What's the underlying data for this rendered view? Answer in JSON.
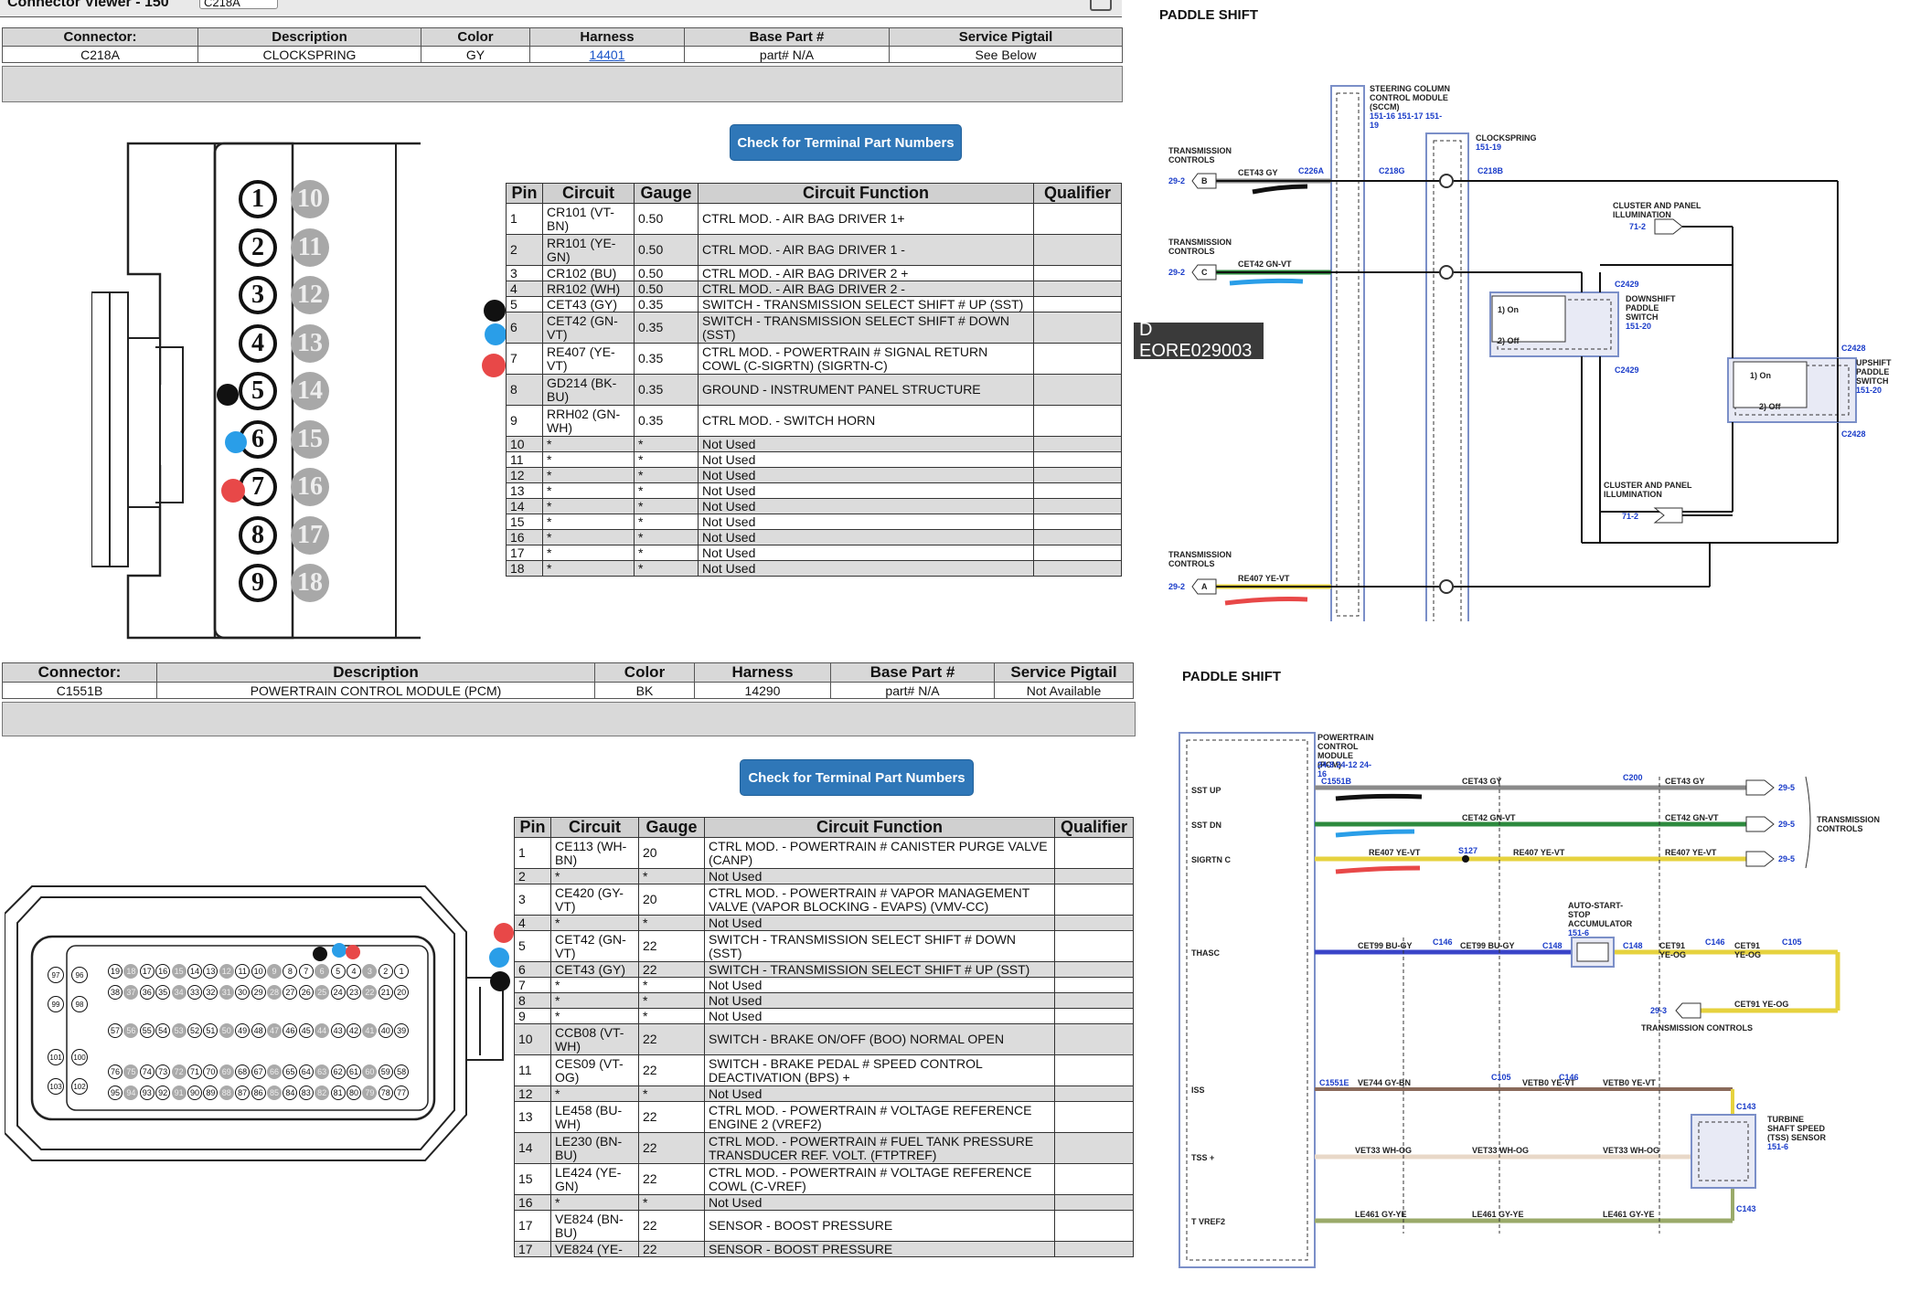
{
  "top_connector": {
    "viewer_label": "Connector Viewer - 150",
    "viewer_select": "C218A",
    "headers": [
      "Connector:",
      "Description",
      "Color",
      "Harness",
      "Base Part #",
      "Service Pigtail"
    ],
    "values": [
      "C218A",
      "CLOCKSPRING",
      "GY",
      "14401",
      "part# N/A",
      "See Below"
    ],
    "button": "Check for Terminal Part Numbers",
    "pin_headers": [
      "Pin",
      "Circuit",
      "Gauge",
      "Circuit Function",
      "Qualifier"
    ],
    "pins": [
      [
        "1",
        "CR101 (VT-BN)",
        "0.50",
        "CTRL MOD. - AIR BAG DRIVER 1+",
        ""
      ],
      [
        "2",
        "RR101 (YE-GN)",
        "0.50",
        "CTRL MOD. - AIR BAG DRIVER 1 -",
        ""
      ],
      [
        "3",
        "CR102 (BU)",
        "0.50",
        "CTRL MOD. - AIR BAG DRIVER 2 +",
        ""
      ],
      [
        "4",
        "RR102 (WH)",
        "0.50",
        "CTRL MOD. - AIR BAG DRIVER 2 -",
        ""
      ],
      [
        "5",
        "CET43 (GY)",
        "0.35",
        "SWITCH - TRANSMISSION SELECT SHIFT # UP (SST)",
        ""
      ],
      [
        "6",
        "CET42 (GN-VT)",
        "0.35",
        "SWITCH - TRANSMISSION SELECT SHIFT # DOWN (SST)",
        ""
      ],
      [
        "7",
        "RE407 (YE-VT)",
        "0.35",
        "CTRL MOD. - POWERTRAIN # SIGNAL RETURN COWL (C-SIGRTN) (SIGRTN-C)",
        ""
      ],
      [
        "8",
        "GD214 (BK-BU)",
        "0.35",
        "GROUND - INSTRUMENT PANEL STRUCTURE",
        ""
      ],
      [
        "9",
        "RRH02 (GN-WH)",
        "0.35",
        "CTRL MOD. - SWITCH HORN",
        ""
      ],
      [
        "10",
        "*",
        "*",
        "Not Used",
        ""
      ],
      [
        "11",
        "*",
        "*",
        "Not Used",
        ""
      ],
      [
        "12",
        "*",
        "*",
        "Not Used",
        ""
      ],
      [
        "13",
        "*",
        "*",
        "Not Used",
        ""
      ],
      [
        "14",
        "*",
        "*",
        "Not Used",
        ""
      ],
      [
        "15",
        "*",
        "*",
        "Not Used",
        ""
      ],
      [
        "16",
        "*",
        "*",
        "Not Used",
        ""
      ],
      [
        "17",
        "*",
        "*",
        "Not Used",
        ""
      ],
      [
        "18",
        "*",
        "*",
        "Not Used",
        ""
      ]
    ],
    "face_left": [
      "1",
      "2",
      "3",
      "4",
      "5",
      "6",
      "7",
      "8",
      "9"
    ],
    "face_right": [
      "10",
      "11",
      "12",
      "13",
      "14",
      "15",
      "16",
      "17",
      "18"
    ]
  },
  "bottom_connector": {
    "headers": [
      "Connector:",
      "Description",
      "Color",
      "Harness",
      "Base Part #",
      "Service Pigtail"
    ],
    "values": [
      "C1551B",
      "POWERTRAIN CONTROL MODULE (PCM)",
      "BK",
      "14290",
      "part# N/A",
      "Not Available"
    ],
    "button": "Check for Terminal Part Numbers",
    "pin_headers": [
      "Pin",
      "Circuit",
      "Gauge",
      "Circuit Function",
      "Qualifier"
    ],
    "pins": [
      [
        "1",
        "CE113 (WH-BN)",
        "20",
        "CTRL MOD. - POWERTRAIN # CANISTER PURGE VALVE (CANP)",
        ""
      ],
      [
        "2",
        "*",
        "*",
        "Not Used",
        ""
      ],
      [
        "3",
        "CE420 (GY-VT)",
        "20",
        "CTRL MOD. - POWERTRAIN # VAPOR MANAGEMENT VALVE (VAPOR BLOCKING - EVAPS) (VMV-CC)",
        ""
      ],
      [
        "4",
        "*",
        "*",
        "Not Used",
        ""
      ],
      [
        "5",
        "CET42 (GN-VT)",
        "22",
        "SWITCH - TRANSMISSION SELECT SHIFT # DOWN (SST)",
        ""
      ],
      [
        "6",
        "CET43 (GY)",
        "22",
        "SWITCH - TRANSMISSION SELECT SHIFT # UP (SST)",
        ""
      ],
      [
        "7",
        "*",
        "*",
        "Not Used",
        ""
      ],
      [
        "8",
        "*",
        "*",
        "Not Used",
        ""
      ],
      [
        "9",
        "*",
        "*",
        "Not Used",
        ""
      ],
      [
        "10",
        "CCB08 (VT-WH)",
        "22",
        "SWITCH - BRAKE ON/OFF (BOO) NORMAL OPEN",
        ""
      ],
      [
        "11",
        "CES09 (VT-OG)",
        "22",
        "SWITCH - BRAKE PEDAL # SPEED CONTROL DEACTIVATION (BPS) +",
        ""
      ],
      [
        "12",
        "*",
        "*",
        "Not Used",
        ""
      ],
      [
        "13",
        "LE458 (BU-WH)",
        "22",
        "CTRL MOD. - POWERTRAIN # VOLTAGE REFERENCE ENGINE 2 (VREF2)",
        ""
      ],
      [
        "14",
        "LE230 (BN-BU)",
        "22",
        "CTRL MOD. - POWERTRAIN # FUEL TANK PRESSURE TRANSDUCER REF. VOLT. (FTPTREF)",
        ""
      ],
      [
        "15",
        "LE424 (YE-GN)",
        "22",
        "CTRL MOD. - POWERTRAIN # VOLTAGE REFERENCE COWL (C-VREF)",
        ""
      ],
      [
        "16",
        "*",
        "*",
        "Not Used",
        ""
      ],
      [
        "17",
        "VE824 (BN-BU)",
        "22",
        "SENSOR - BOOST PRESSURE",
        ""
      ],
      [
        "17",
        "VE824 (YE-",
        "22",
        "SENSOR - BOOST PRESSURE",
        ""
      ]
    ],
    "face_row1": [
      "19",
      "18",
      "17",
      "16",
      "15",
      "14",
      "13",
      "12",
      "11",
      "10",
      "9",
      "8",
      "7",
      "6",
      "5",
      "4",
      "3",
      "2",
      "1"
    ],
    "face_row2": [
      "38",
      "37",
      "36",
      "35",
      "34",
      "33",
      "32",
      "31",
      "30",
      "29",
      "28",
      "27",
      "26",
      "25",
      "24",
      "23",
      "22",
      "21",
      "20"
    ],
    "face_row3": [
      "57",
      "56",
      "55",
      "54",
      "53",
      "52",
      "51",
      "50",
      "49",
      "48",
      "47",
      "46",
      "45",
      "44",
      "43",
      "42",
      "41",
      "40",
      "39"
    ],
    "face_row4": [
      "76",
      "75",
      "74",
      "73",
      "72",
      "71",
      "70",
      "69",
      "68",
      "67",
      "66",
      "65",
      "64",
      "63",
      "62",
      "61",
      "60",
      "59",
      "58"
    ],
    "face_row5": [
      "95",
      "94",
      "93",
      "92",
      "91",
      "90",
      "89",
      "88",
      "87",
      "86",
      "85",
      "84",
      "83",
      "82",
      "81",
      "80",
      "79",
      "78",
      "77"
    ],
    "face_left": [
      "97",
      "96",
      "99",
      "98",
      "101",
      "100",
      "103",
      "102"
    ]
  },
  "overlay_label": "D EORE029003",
  "diagram_top": {
    "title": "PADDLE SHIFT",
    "sccm": "STEERING COLUMN CONTROL MODULE (SCCM)",
    "sccm_ref": "151-16  151-17  151-19",
    "clockspring": "CLOCKSPRING",
    "clockspring_ref": "151-19",
    "tc": "TRANSMISSION CONTROLS",
    "ref_29_2": "29-2",
    "pin_b": "B",
    "pin_c": "C",
    "pin_a": "A",
    "w1": "CET43  GY",
    "w2": "CET42  GN-VT",
    "w3": "RE407  YE-VT",
    "c226a": "C226A",
    "c218g": "C218G",
    "c218b": "C218B",
    "cluster": "CLUSTER AND PANEL ILLUMINATION",
    "ref_71_2": "71-2",
    "downshift": "DOWNSHIFT PADDLE SWITCH",
    "downshift_ref": "151-20",
    "upshift": "UPSHIFT PADDLE SWITCH",
    "upshift_ref": "151-20",
    "on": "1) On",
    "off": "2) Off",
    "c2429": "C2429",
    "c2428": "C2428"
  },
  "diagram_bottom": {
    "title": "PADDLE SHIFT",
    "pcm": "POWERTRAIN CONTROL MODULE (PCM)",
    "pcm_ref": "24-8  24-12  24-16",
    "c1551b": "C1551B",
    "rows": [
      "SST UP",
      "SST DN",
      "SIGRTN C",
      "THASC",
      "ISS",
      "TSS +",
      "T VREF2"
    ],
    "w_cet43": "CET43  GY",
    "w_cet42": "CET42  GN-VT",
    "w_re407": "RE407  YE-VT",
    "w_cet99": "CET99  BU-GY",
    "w_cet91": "CET91  YE-OG",
    "w_ve744": "VE744  GY-BN",
    "w_vetb0": "VETB0  YE-VT",
    "w_vet33": "VET33  WH-OG",
    "w_le461": "LE461  GY-YE",
    "c200": "C200",
    "s127": "S127",
    "c146": "C146",
    "c148": "C148",
    "c105": "C105",
    "c1551e": "C1551E",
    "c143": "C143",
    "accum": "AUTO-START-STOP ACCUMULATOR",
    "accum_ref": "151-6",
    "tc": "TRANSMISSION CONTROLS",
    "ref_29_5": "29-5",
    "ref_29_3": "29-3",
    "tss": "TURBINE SHAFT SPEED (TSS) SENSOR",
    "tss_ref": "151-6"
  }
}
